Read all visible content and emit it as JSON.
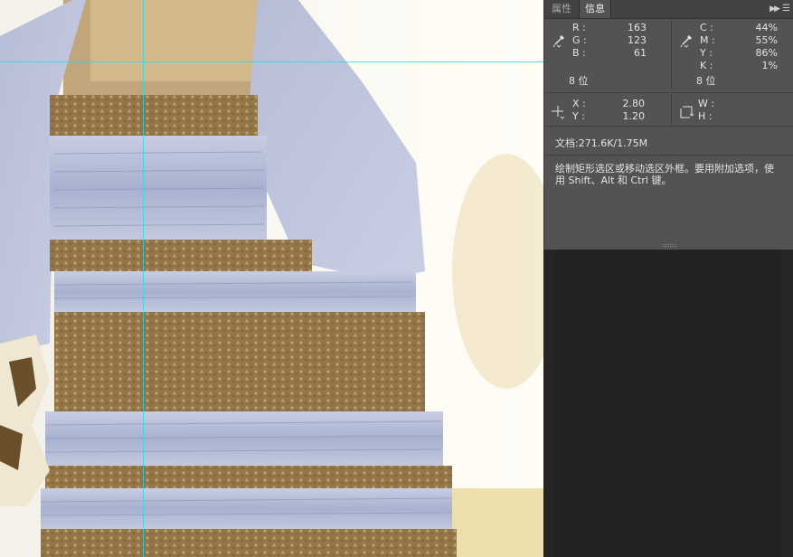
{
  "panel": {
    "tabs": [
      "属性",
      "信息"
    ],
    "active_tab": "信息",
    "icons": [
      "collapse-icon",
      "panel-menu-icon",
      "eyedropper-icon",
      "crosshair-icon",
      "selection-size-icon"
    ],
    "rgb": {
      "r_label": "R :",
      "r": "163",
      "g_label": "G :",
      "g": "123",
      "b_label": "B :",
      "b": "61",
      "bits": "8 位"
    },
    "cmyk": {
      "c_label": "C :",
      "c": "44%",
      "m_label": "M :",
      "m": "55%",
      "y_label": "Y :",
      "y": "86%",
      "k_label": "K :",
      "k": "1%",
      "bits": "8 位"
    },
    "position": {
      "x_label": "X :",
      "x": "2.80",
      "y_label": "Y :",
      "y": "1.20"
    },
    "size": {
      "w_label": "W :",
      "w": "",
      "h_label": "H :",
      "h": ""
    },
    "document": "文档:271.6K/1.75M",
    "hint": "绘制矩形选区或移动选区外框。要用附加选项，使用 Shift、Alt 和 Ctrl 键。"
  },
  "colors": {
    "panel_bg": "#535353",
    "tabbar_bg": "#434343",
    "workspace_bg": "#262626",
    "guide": "#35d6e6",
    "dress_blue": "#b9c1dc",
    "dress_gold": "#9a7d4c"
  }
}
